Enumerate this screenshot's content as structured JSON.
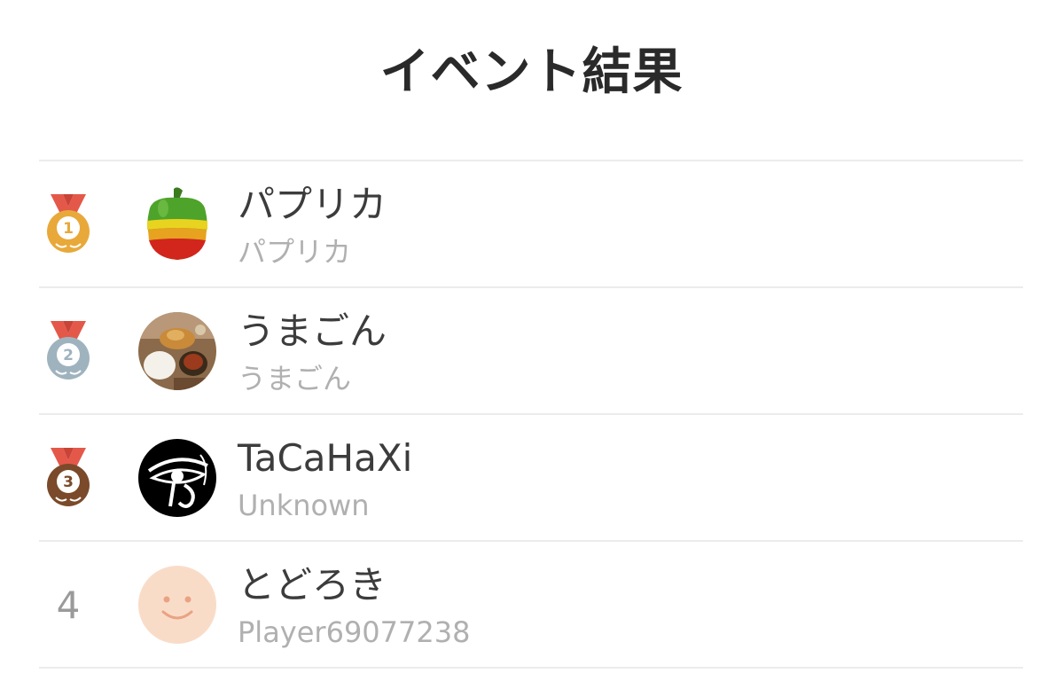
{
  "header": {
    "title": "イベント結果"
  },
  "results": [
    {
      "rank": "1",
      "medal": "gold-medal-icon",
      "medal_color": "#e8a93a",
      "avatar": "paprika-avatar",
      "name": "パプリカ",
      "sub": "パプリカ"
    },
    {
      "rank": "2",
      "medal": "silver-medal-icon",
      "medal_color": "#9fb3bf",
      "avatar": "food-plate-avatar",
      "name": "うまごん",
      "sub": "うまごん"
    },
    {
      "rank": "3",
      "medal": "bronze-medal-icon",
      "medal_color": "#7a4a2a",
      "avatar": "eye-of-horus-avatar",
      "name": "TaCaHaXi",
      "sub": "Unknown"
    },
    {
      "rank": "4",
      "medal": "",
      "avatar": "default-smiley-avatar",
      "name": "とどろき",
      "sub": "Player69077238"
    }
  ],
  "colors": {
    "ribbon": "#e4584a",
    "divider": "#ececec",
    "name": "#3c3c3c",
    "sub": "#b0b0b0"
  }
}
